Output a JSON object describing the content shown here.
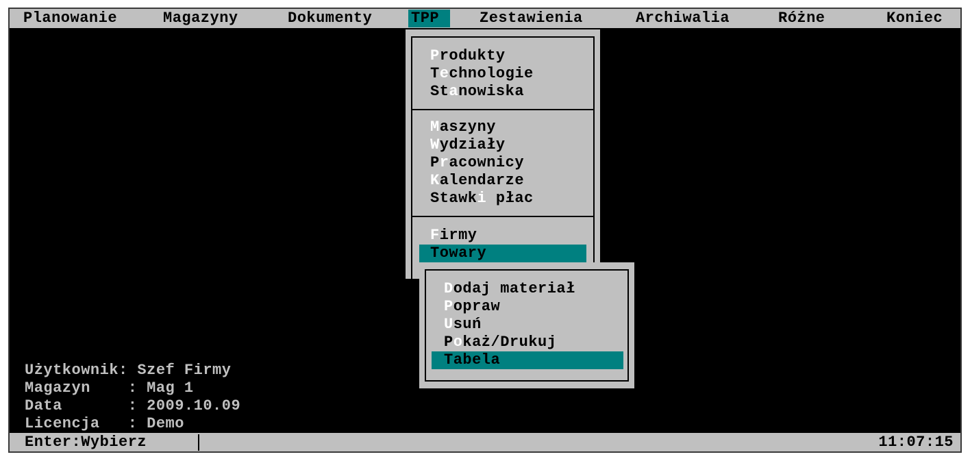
{
  "menubar": {
    "items": [
      {
        "label": "Planowanie"
      },
      {
        "label": "Magazyny"
      },
      {
        "label": "Dokumenty"
      },
      {
        "label": "TPP",
        "active": true
      },
      {
        "label": "Zestawienia"
      },
      {
        "label": "Archiwalia"
      },
      {
        "label": "Różne"
      },
      {
        "label": "Koniec"
      }
    ]
  },
  "tpp_menu": {
    "group1": [
      {
        "hot": "P",
        "rest": "rodukty"
      },
      {
        "pre": "T",
        "hot": "e",
        "rest": "chnologie"
      },
      {
        "pre": "St",
        "hot": "a",
        "rest": "nowiska"
      }
    ],
    "group2": [
      {
        "hot": "M",
        "rest": "aszyny"
      },
      {
        "hot": "W",
        "rest": "ydziały"
      },
      {
        "pre": "P",
        "hot": "r",
        "rest": "acownicy"
      },
      {
        "hot": "K",
        "rest": "alendarze"
      },
      {
        "pre": "Stawk",
        "hot": "i",
        "rest": " płac"
      }
    ],
    "group3": [
      {
        "hot": "F",
        "rest": "irmy"
      },
      {
        "label": "Towary",
        "selected": true
      }
    ]
  },
  "towary_submenu": {
    "items": [
      {
        "hot": "D",
        "rest": "odaj materiał"
      },
      {
        "hot": "P",
        "rest": "opraw"
      },
      {
        "hot": "U",
        "rest": "suń"
      },
      {
        "pre": "P",
        "hot": "o",
        "rest": "każ/Drukuj"
      },
      {
        "label": "Tabela",
        "selected": true
      }
    ]
  },
  "info": {
    "user": "Użytkownik: Szef Firmy",
    "warehouse": "Magazyn    : Mag 1",
    "date": "Data       : 2009.10.09",
    "license": "Licencja   : Demo"
  },
  "statusbar": {
    "hint": "Enter:Wybierz",
    "time": "11:07:15"
  },
  "colors": {
    "screen_bg": "#000000",
    "menu_bg": "#c0c0c0",
    "highlight": "#008080",
    "hotkey": "#ffffff",
    "info_text": "#c0c0c0"
  }
}
